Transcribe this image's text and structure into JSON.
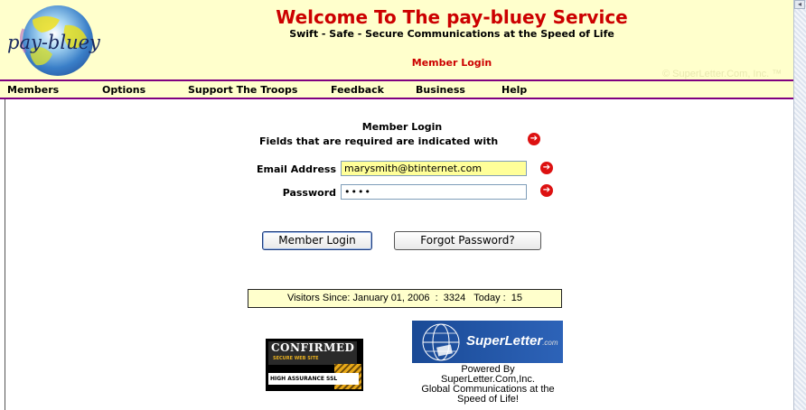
{
  "header": {
    "logo_text": "pay-bluey",
    "title": "Welcome To The pay-bluey Service",
    "tagline": "Swift - Safe - Secure Communications at the Speed of Life",
    "subtitle": "Member Login",
    "copyright": "© SuperLetter.Com, Inc. ™"
  },
  "nav": {
    "items": [
      {
        "label": "Members"
      },
      {
        "label": "Options"
      },
      {
        "label": "Support The Troops"
      },
      {
        "label": "Feedback"
      },
      {
        "label": "Business"
      },
      {
        "label": "Help"
      }
    ]
  },
  "form": {
    "heading": "Member Login",
    "required_note": "Fields that are required are indicated with",
    "email_label": "Email Address",
    "email_value": "marysmith@btinternet.com",
    "password_label": "Password",
    "password_value": "••••",
    "login_button": "Member Login",
    "forgot_button": "Forgot Password?"
  },
  "counter": {
    "text": "Visitors Since: January 01, 2006  :  3324   Today :  15"
  },
  "badges": {
    "ssl_title": "CONFIRMED",
    "ssl_sub": "SECURE WEB SITE",
    "ssl_bottom": "HIGH ASSURANCE SSL",
    "superletter_text": "SuperLetter",
    "superletter_suffix": ".com"
  },
  "powered": {
    "lines": [
      "Powered By",
      "SuperLetter.Com,Inc.",
      "Global Communications at the",
      "Speed of Life!"
    ]
  },
  "colors": {
    "header_bg": "#ffffcc",
    "rule": "#800080",
    "title": "#cc0000",
    "required_icon": "#dd1111"
  },
  "icons": {
    "required": "red-circle-arrow-icon",
    "logo": "globe-logo"
  }
}
